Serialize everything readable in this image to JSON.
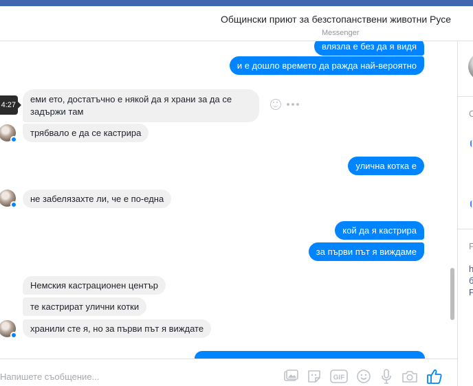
{
  "header": {
    "title": "Общински приют за безстопанствени животни Русе",
    "subtitle": "Messenger"
  },
  "tooltip": "4:27",
  "messages": {
    "m1": "влязла е без да я видя",
    "m2": "и е дошло времето да ражда най-вероятно",
    "m3": "еми ето, достатъчно е някой да я храни за да се задържи там",
    "m4": "трябвало е да се кастрира",
    "m5": "улична котка е",
    "m6": "не забелязахте ли, че е по-една",
    "m7": "кой да я кастрира",
    "m8": "за първи път я виждаме",
    "m9": "Немския кастрационен център",
    "m10": "те кастрират улични котки",
    "m11": "хранили сте я, но за първи път я виждате"
  },
  "composer": {
    "placeholder": "Напишете съобщение..."
  },
  "right_panel": {
    "section1_letter": "С",
    "section2_letter": "F",
    "link_lines": [
      "h",
      "б",
      "Р"
    ]
  },
  "colors": {
    "accent": "#0084ff",
    "topbar": "#4267b2",
    "incoming_bubble": "#f1f0f0"
  },
  "icons": [
    "smile-icon",
    "more-icon",
    "photo-icon",
    "sticker-icon",
    "gif-icon",
    "emoji-icon",
    "microphone-icon",
    "camera-icon",
    "like-icon"
  ]
}
